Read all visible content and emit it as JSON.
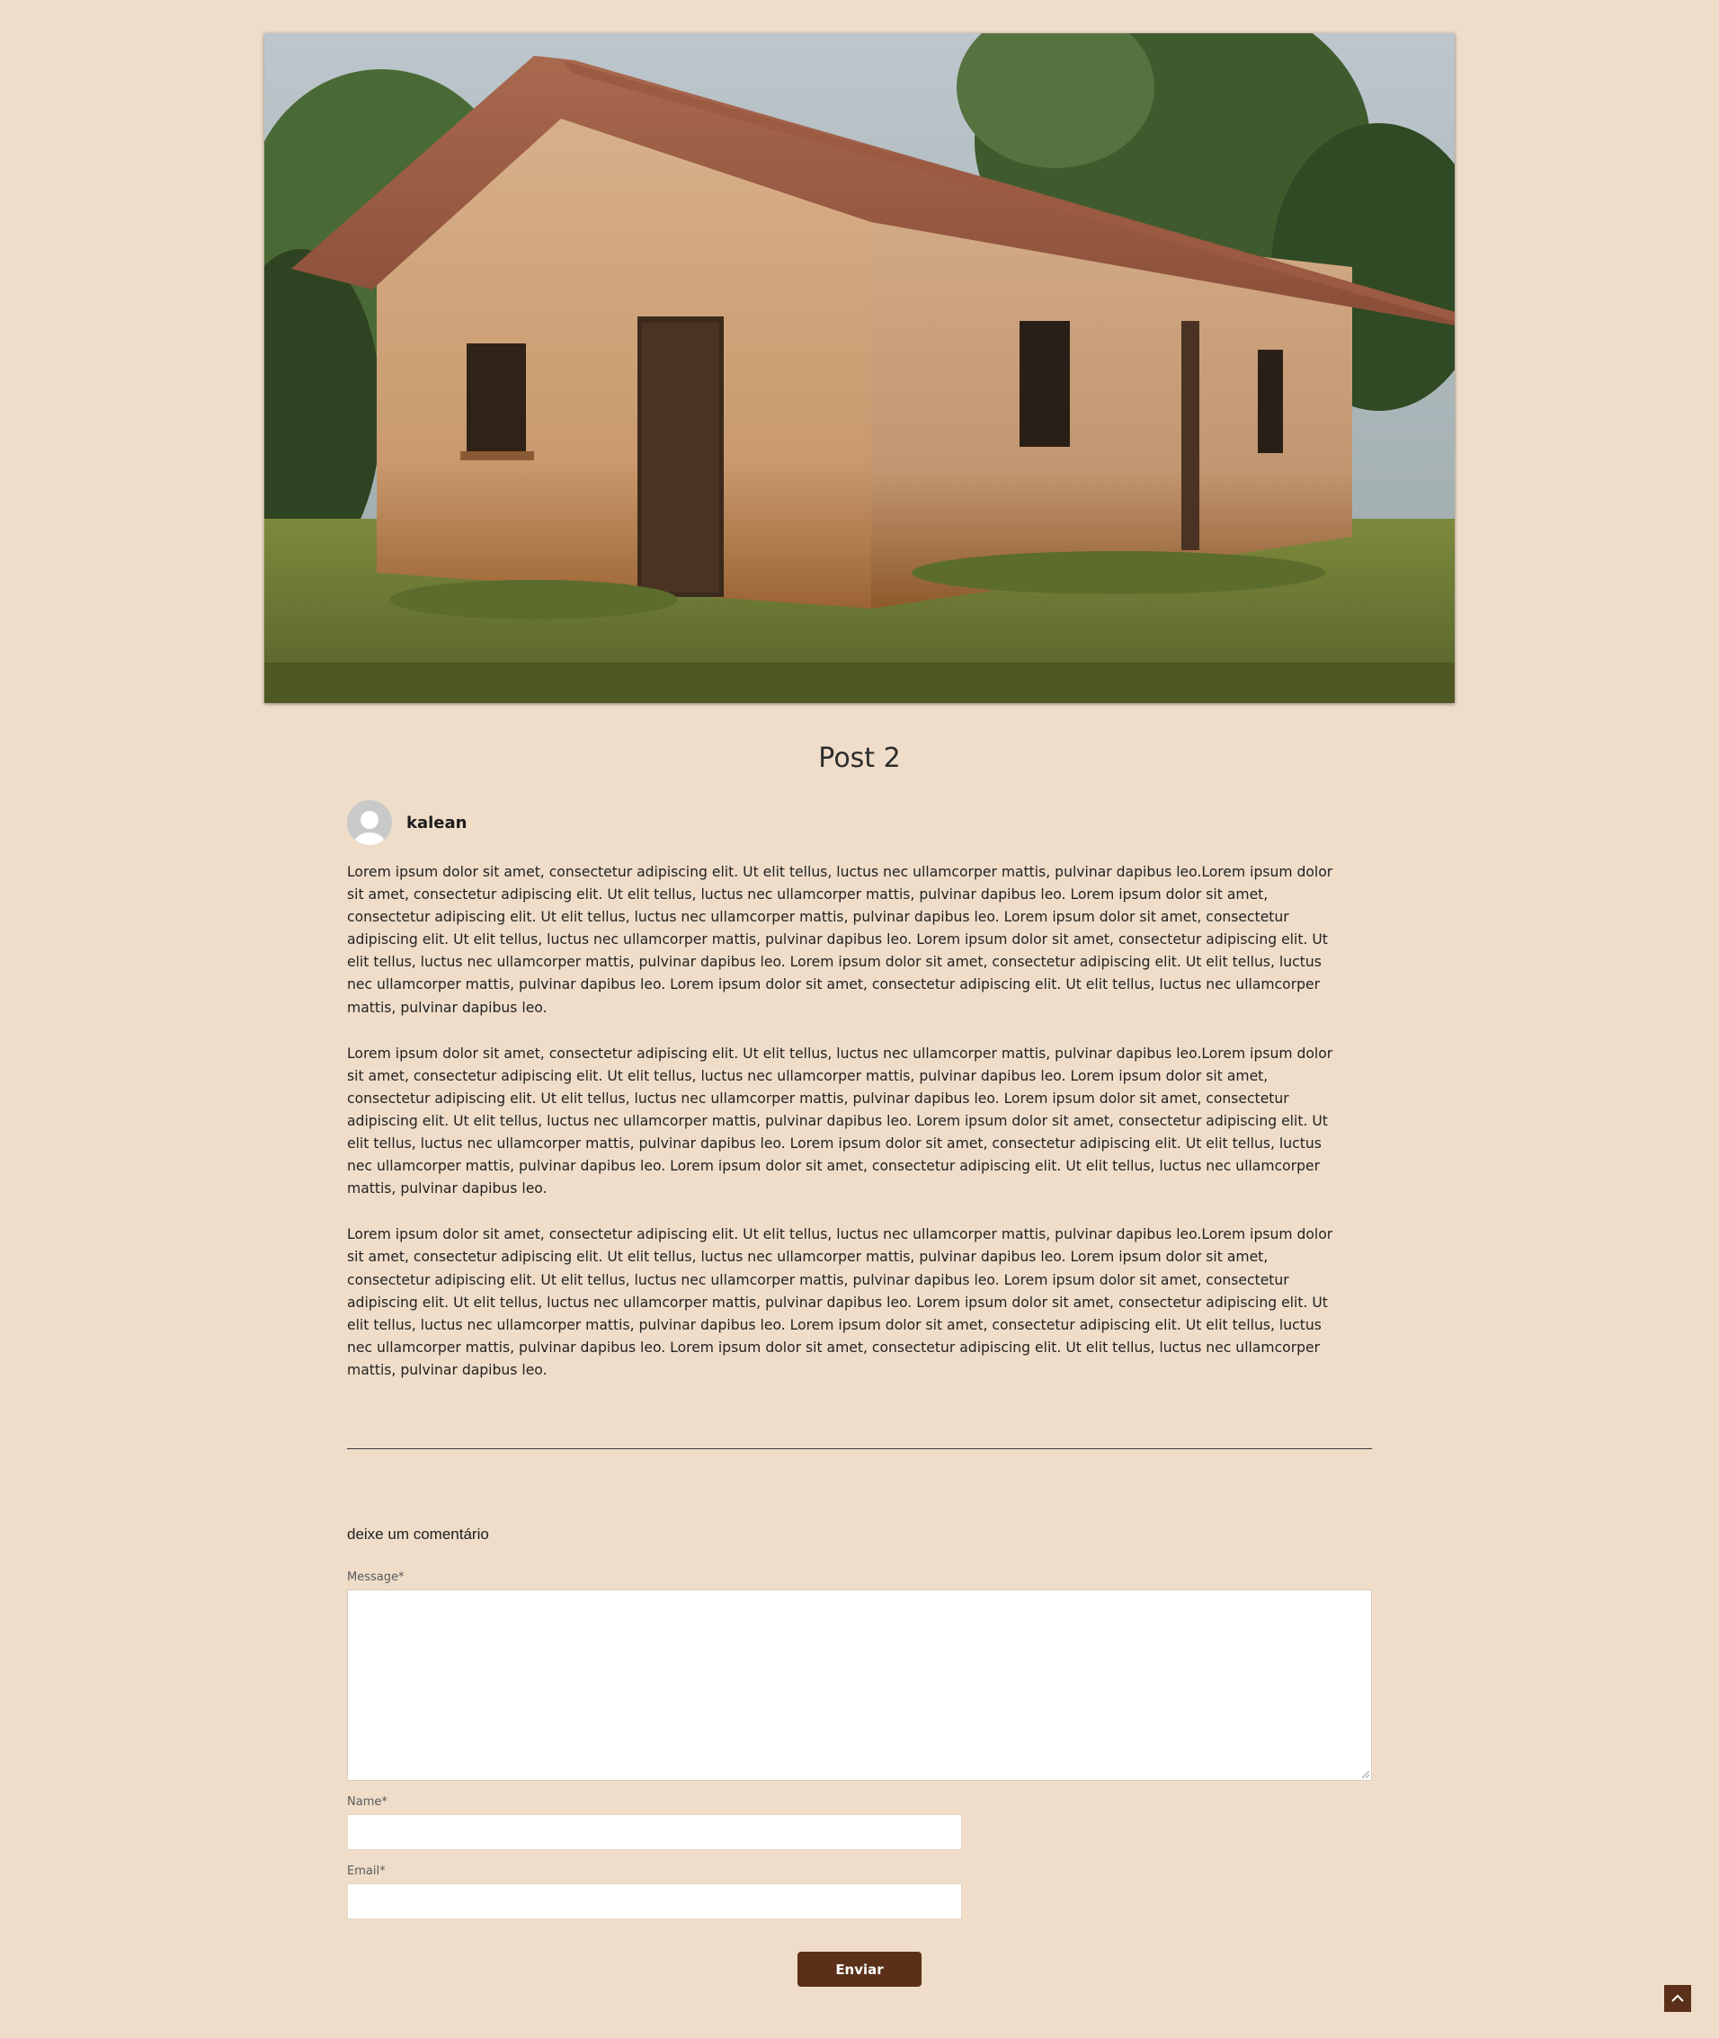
{
  "post": {
    "title": "Post 2",
    "author": "kalean",
    "paragraphs": [
      "Lorem ipsum dolor sit amet, consectetur adipiscing elit. Ut elit tellus, luctus nec ullamcorper mattis, pulvinar dapibus leo.Lorem ipsum dolor sit amet, consectetur adipiscing elit. Ut elit tellus, luctus nec ullamcorper mattis, pulvinar dapibus leo. Lorem ipsum dolor sit amet, consectetur adipiscing elit. Ut elit tellus, luctus nec ullamcorper mattis, pulvinar dapibus leo. Lorem ipsum dolor sit amet, consectetur adipiscing elit. Ut elit tellus, luctus nec ullamcorper mattis, pulvinar dapibus leo. Lorem ipsum dolor sit amet, consectetur adipiscing elit. Ut elit tellus, luctus nec ullamcorper mattis, pulvinar dapibus leo. Lorem ipsum dolor sit amet, consectetur adipiscing elit. Ut elit tellus, luctus nec ullamcorper mattis, pulvinar dapibus leo. Lorem ipsum dolor sit amet, consectetur adipiscing elit. Ut elit tellus, luctus nec ullamcorper mattis, pulvinar dapibus leo.",
      "Lorem ipsum dolor sit amet, consectetur adipiscing elit. Ut elit tellus, luctus nec ullamcorper mattis, pulvinar dapibus leo.Lorem ipsum dolor sit amet, consectetur adipiscing elit. Ut elit tellus, luctus nec ullamcorper mattis, pulvinar dapibus leo. Lorem ipsum dolor sit amet, consectetur adipiscing elit. Ut elit tellus, luctus nec ullamcorper mattis, pulvinar dapibus leo. Lorem ipsum dolor sit amet, consectetur adipiscing elit. Ut elit tellus, luctus nec ullamcorper mattis, pulvinar dapibus leo. Lorem ipsum dolor sit amet, consectetur adipiscing elit. Ut elit tellus, luctus nec ullamcorper mattis, pulvinar dapibus leo. Lorem ipsum dolor sit amet, consectetur adipiscing elit. Ut elit tellus, luctus nec ullamcorper mattis, pulvinar dapibus leo. Lorem ipsum dolor sit amet, consectetur adipiscing elit. Ut elit tellus, luctus nec ullamcorper mattis, pulvinar dapibus leo.",
      "Lorem ipsum dolor sit amet, consectetur adipiscing elit. Ut elit tellus, luctus nec ullamcorper mattis, pulvinar dapibus leo.Lorem ipsum dolor sit amet, consectetur adipiscing elit. Ut elit tellus, luctus nec ullamcorper mattis, pulvinar dapibus leo. Lorem ipsum dolor sit amet, consectetur adipiscing elit. Ut elit tellus, luctus nec ullamcorper mattis, pulvinar dapibus leo. Lorem ipsum dolor sit amet, consectetur adipiscing elit. Ut elit tellus, luctus nec ullamcorper mattis, pulvinar dapibus leo. Lorem ipsum dolor sit amet, consectetur adipiscing elit. Ut elit tellus, luctus nec ullamcorper mattis, pulvinar dapibus leo. Lorem ipsum dolor sit amet, consectetur adipiscing elit. Ut elit tellus, luctus nec ullamcorper mattis, pulvinar dapibus leo. Lorem ipsum dolor sit amet, consectetur adipiscing elit. Ut elit tellus, luctus nec ullamcorper mattis, pulvinar dapibus leo."
    ]
  },
  "comment_form": {
    "heading": "deixe um comentário",
    "message_label": "Message*",
    "message_value": "",
    "name_label": "Name*",
    "name_value": "",
    "email_label": "Email*",
    "email_value": "",
    "submit_label": "Enviar"
  },
  "icons": {
    "hero": "house-photo",
    "avatar": "user-avatar-icon",
    "scroll_top": "chevron-up-icon"
  },
  "colors": {
    "background": "#efddc9",
    "accent": "#5a3118"
  }
}
